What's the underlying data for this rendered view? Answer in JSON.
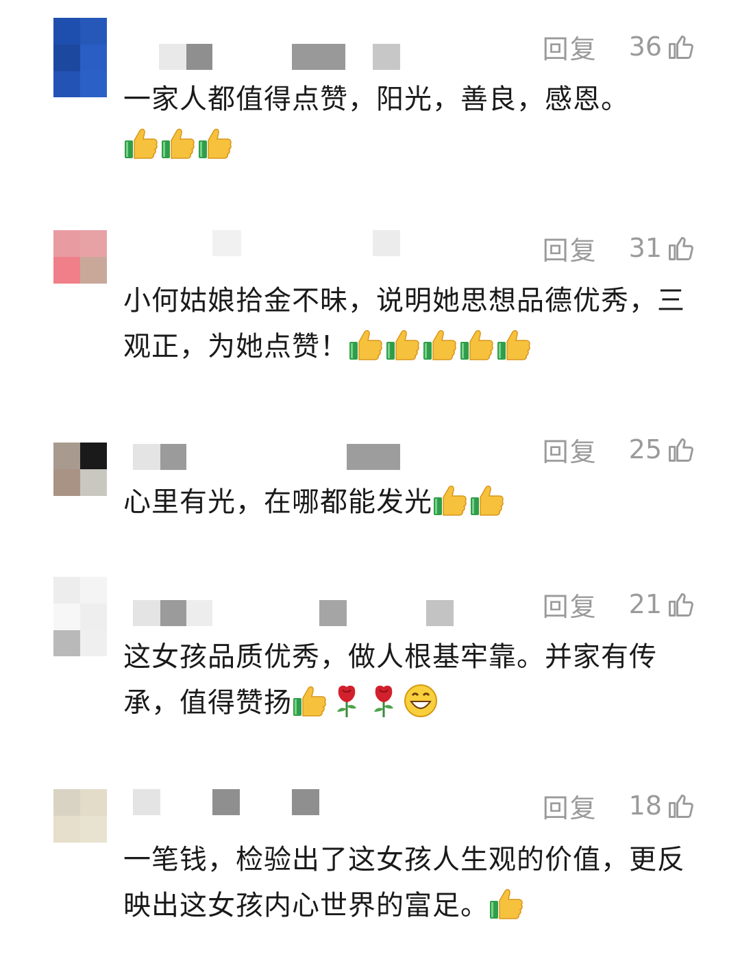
{
  "reply_label": "回复",
  "comments": [
    {
      "likes": "36",
      "text": "一家人都值得点赞，阳光，善良，感恩。",
      "emojis": [
        "thumbs-up",
        "thumbs-up",
        "thumbs-up"
      ],
      "avatar_colors": [
        "#1f4fae",
        "#2558b8",
        "#1d48a0",
        "#2a5ec4",
        "#2253b5",
        "#2b61c6"
      ]
    },
    {
      "likes": "31",
      "text": "小何姑娘拾金不昧，说明她思想品德优秀，三观正，为她点赞！",
      "emojis": [
        "thumbs-up",
        "thumbs-up",
        "thumbs-up",
        "thumbs-up",
        "thumbs-up"
      ],
      "avatar_colors": [
        "#e99ba2",
        "#e7a2a6",
        "#ef7f88",
        "#c9a89a",
        "#ffffff",
        "#ffffff"
      ]
    },
    {
      "likes": "25",
      "text": "心里有光，在哪都能发光",
      "emojis": [
        "thumbs-up",
        "thumbs-up"
      ],
      "avatar_colors": [
        "#a89a8f",
        "#1a1a1a",
        "#a99385",
        "#c9c8c0",
        "#ffffff",
        "#ffffff"
      ]
    },
    {
      "likes": "21",
      "text": "这女孩品质优秀，做人根基牢靠。并家有传承，值得赞扬",
      "emojis": [
        "thumbs-up",
        "rose",
        "rose",
        "grin"
      ],
      "avatar_colors": [
        "#ededed",
        "#f4f4f4",
        "#f7f7f7",
        "#eeeeee",
        "#b9b9b9",
        "#efefef"
      ]
    },
    {
      "likes": "18",
      "text": "一笔钱，检验出了这女孩人生观的价值，更反映出这女孩内心世界的富足。",
      "emojis": [
        "thumbs-up"
      ],
      "avatar_colors": [
        "#d9d3c3",
        "#e3dcc9",
        "#e6dfcc",
        "#e8e2d0",
        "#ffffff",
        "#ffffff"
      ]
    }
  ]
}
